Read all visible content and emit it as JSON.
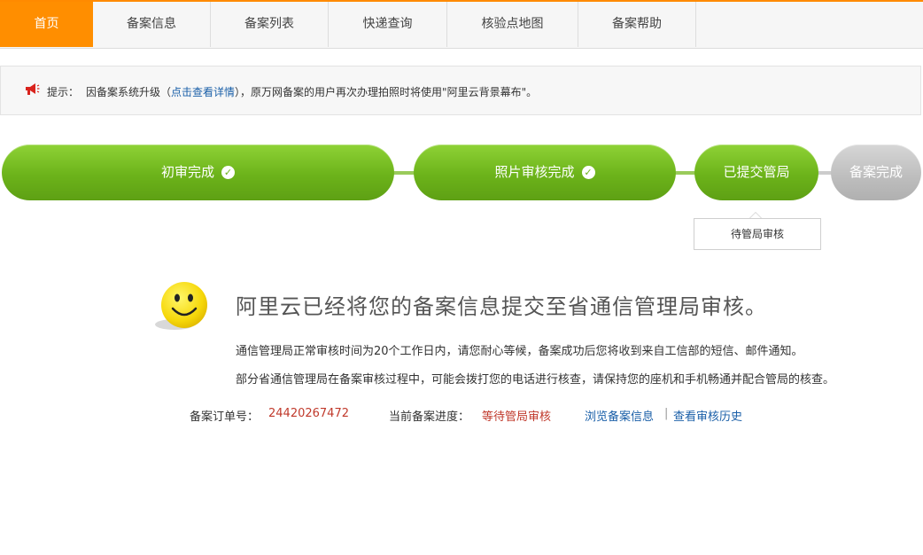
{
  "nav": {
    "tabs": [
      "首页",
      "备案信息",
      "备案列表",
      "快递查询",
      "核验点地图",
      "备案帮助"
    ],
    "active_index": 0
  },
  "notice": {
    "label": "提示：",
    "text_before": "因备案系统升级（",
    "link": "点击查看详情",
    "text_after": "），原万网备案的用户再次办理拍照时将使用\"阿里云背景幕布\"。"
  },
  "steps": [
    {
      "label": "初审完成",
      "done": true
    },
    {
      "label": "照片审核完成",
      "done": true
    },
    {
      "label": "已提交管局",
      "done": false
    },
    {
      "label": "备案完成",
      "done": false
    }
  ],
  "current_status": "待管局审核",
  "message": {
    "title": "阿里云已经将您的备案信息提交至省通信管理局审核。",
    "line1": "通信管理局正常审核时间为20个工作日内，请您耐心等候，备案成功后您将收到来自工信部的短信、邮件通知。",
    "line2": "部分省通信管理局在备案审核过程中，可能会拨打您的电话进行核查，请保持您的座机和手机畅通并配合管局的核查。"
  },
  "order": {
    "label": "备案订单号：",
    "number": "24420267472",
    "progress_label": "当前备案进度：",
    "progress_value": "等待管局审核",
    "link_view": "浏览备案信息",
    "separator": "|",
    "link_history": "查看审核历史"
  },
  "colors": {
    "accent_orange": "#ff8e00",
    "step_green": "#6cb31a",
    "step_gray": "#bdbdbd",
    "link_blue": "#1a5fa8",
    "value_red": "#c0392b"
  }
}
